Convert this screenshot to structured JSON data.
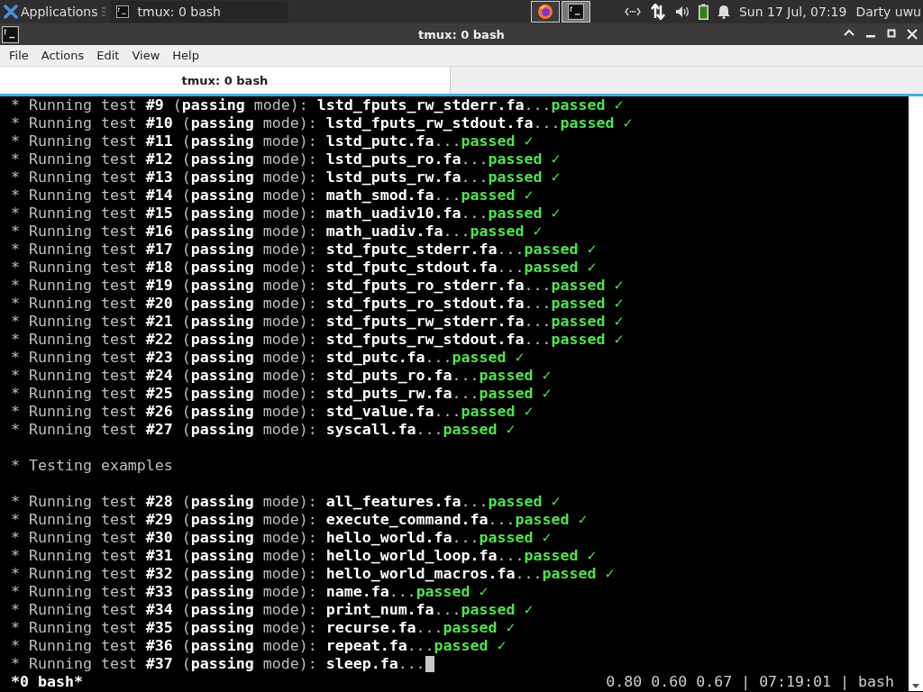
{
  "panel": {
    "apps_label": "Applications",
    "tasks": [
      {
        "label": "tmux: 0 bash",
        "selected": true
      }
    ],
    "launchers": [
      {
        "kind": "browser",
        "selected": false
      },
      {
        "kind": "terminal",
        "selected": true
      }
    ],
    "clock": "Sun 17 Jul, 07:19",
    "user": "Darty uwu"
  },
  "window": {
    "title": "tmux: 0 bash"
  },
  "menu": [
    "File",
    "Actions",
    "Edit",
    "View",
    "Help"
  ],
  "tabs": [
    {
      "label": "tmux: 0 bash",
      "selected": true
    }
  ],
  "terminal": {
    "lines": [
      {
        "kind": "test",
        "text": "* Running test **#9** (**passing** mode): **lstd_fputs_rw_stderr.fa**...",
        "result": "passed ✓"
      },
      {
        "kind": "test",
        "text": "* Running test **#10** (**passing** mode): **lstd_fputs_rw_stdout.fa**...",
        "result": "passed ✓"
      },
      {
        "kind": "test",
        "text": "* Running test **#11** (**passing** mode): **lstd_putc.fa**...",
        "result": "passed ✓"
      },
      {
        "kind": "test",
        "text": "* Running test **#12** (**passing** mode): **lstd_puts_ro.fa**...",
        "result": "passed ✓"
      },
      {
        "kind": "test",
        "text": "* Running test **#13** (**passing** mode): **lstd_puts_rw.fa**...",
        "result": "passed ✓"
      },
      {
        "kind": "test",
        "text": "* Running test **#14** (**passing** mode): **math_smod.fa**...",
        "result": "passed ✓"
      },
      {
        "kind": "test",
        "text": "* Running test **#15** (**passing** mode): **math_uadiv10.fa**...",
        "result": "passed ✓"
      },
      {
        "kind": "test",
        "text": "* Running test **#16** (**passing** mode): **math_uadiv.fa**...",
        "result": "passed ✓"
      },
      {
        "kind": "test",
        "text": "* Running test **#17** (**passing** mode): **std_fputc_stderr.fa**...",
        "result": "passed ✓"
      },
      {
        "kind": "test",
        "text": "* Running test **#18** (**passing** mode): **std_fputc_stdout.fa**...",
        "result": "passed ✓"
      },
      {
        "kind": "test",
        "text": "* Running test **#19** (**passing** mode): **std_fputs_ro_stderr.fa**...",
        "result": "passed ✓"
      },
      {
        "kind": "test",
        "text": "* Running test **#20** (**passing** mode): **std_fputs_ro_stdout.fa**...",
        "result": "passed ✓"
      },
      {
        "kind": "test",
        "text": "* Running test **#21** (**passing** mode): **std_fputs_rw_stderr.fa**...",
        "result": "passed ✓"
      },
      {
        "kind": "test",
        "text": "* Running test **#22** (**passing** mode): **std_fputs_rw_stdout.fa**...",
        "result": "passed ✓"
      },
      {
        "kind": "test",
        "text": "* Running test **#23** (**passing** mode): **std_putc.fa**...",
        "result": "passed ✓"
      },
      {
        "kind": "test",
        "text": "* Running test **#24** (**passing** mode): **std_puts_ro.fa**...",
        "result": "passed ✓"
      },
      {
        "kind": "test",
        "text": "* Running test **#25** (**passing** mode): **std_puts_rw.fa**...",
        "result": "passed ✓"
      },
      {
        "kind": "test",
        "text": "* Running test **#26** (**passing** mode): **std_value.fa**...",
        "result": "passed ✓"
      },
      {
        "kind": "test",
        "text": "* Running test **#27** (**passing** mode): **syscall.fa**...",
        "result": "passed ✓"
      },
      {
        "kind": "blank"
      },
      {
        "kind": "heading",
        "text": "* Testing examples"
      },
      {
        "kind": "blank"
      },
      {
        "kind": "test",
        "text": "* Running test **#28** (**passing** mode): **all_features.fa**...",
        "result": "passed ✓"
      },
      {
        "kind": "test",
        "text": "* Running test **#29** (**passing** mode): **execute_command.fa**...",
        "result": "passed ✓"
      },
      {
        "kind": "test",
        "text": "* Running test **#30** (**passing** mode): **hello_world.fa**...",
        "result": "passed ✓"
      },
      {
        "kind": "test",
        "text": "* Running test **#31** (**passing** mode): **hello_world_loop.fa**...",
        "result": "passed ✓"
      },
      {
        "kind": "test",
        "text": "* Running test **#32** (**passing** mode): **hello_world_macros.fa**...",
        "result": "passed ✓"
      },
      {
        "kind": "test",
        "text": "* Running test **#33** (**passing** mode): **name.fa**...",
        "result": "passed ✓"
      },
      {
        "kind": "test",
        "text": "* Running test **#34** (**passing** mode): **print_num.fa**...",
        "result": "passed ✓"
      },
      {
        "kind": "test",
        "text": "* Running test **#35** (**passing** mode): **recurse.fa**...",
        "result": "passed ✓"
      },
      {
        "kind": "test",
        "text": "* Running test **#36** (**passing** mode): **repeat.fa**...",
        "result": "passed ✓"
      },
      {
        "kind": "running",
        "text": "* Running test **#37** (**passing** mode): **sleep.fa**..."
      }
    ],
    "status_left": "*0 bash*",
    "status_right": "0.80 0.60 0.67 | 07:19:01 | bash"
  }
}
